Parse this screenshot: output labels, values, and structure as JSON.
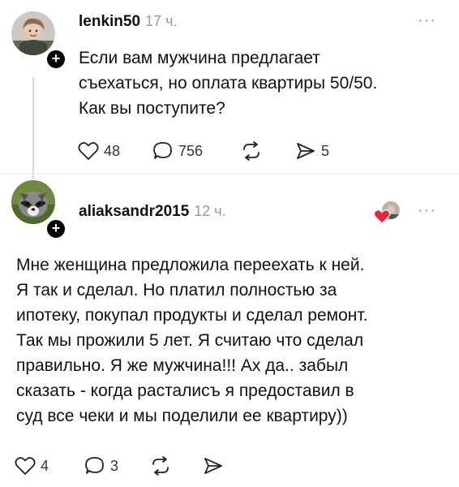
{
  "post": {
    "username": "lenkin50",
    "time": "17 ч.",
    "more": "···",
    "lines": [
      "Если вам мужчина предлагает",
      "съехаться, но оплата квартиры 50/50.",
      "Как вы поступите?"
    ],
    "likes": "48",
    "comments": "756",
    "shares": "5"
  },
  "reply": {
    "username": "aliaksandr2015",
    "time": "12 ч.",
    "more": "···",
    "lines": [
      "Мне женщина предложила переехать к ней.",
      "Я так и сделал. Но платил полностью за",
      "ипотеку, покупал продукты и сделал ремонт.",
      "Так мы прожили 5 лет. Я считаю что сделал",
      "правильно. Я же мужчина!!! Ах да.. забыл",
      "сказать - когда расталисъ я предоставил в",
      "суд все чеки и мы поделили ее квартиру))"
    ],
    "likes": "4",
    "comments": "3"
  },
  "plus_sign": "+",
  "colors": {
    "text": "#111111",
    "meta": "#9a9a9a",
    "heart": "#e8253a",
    "line": "#d9d9d9"
  }
}
